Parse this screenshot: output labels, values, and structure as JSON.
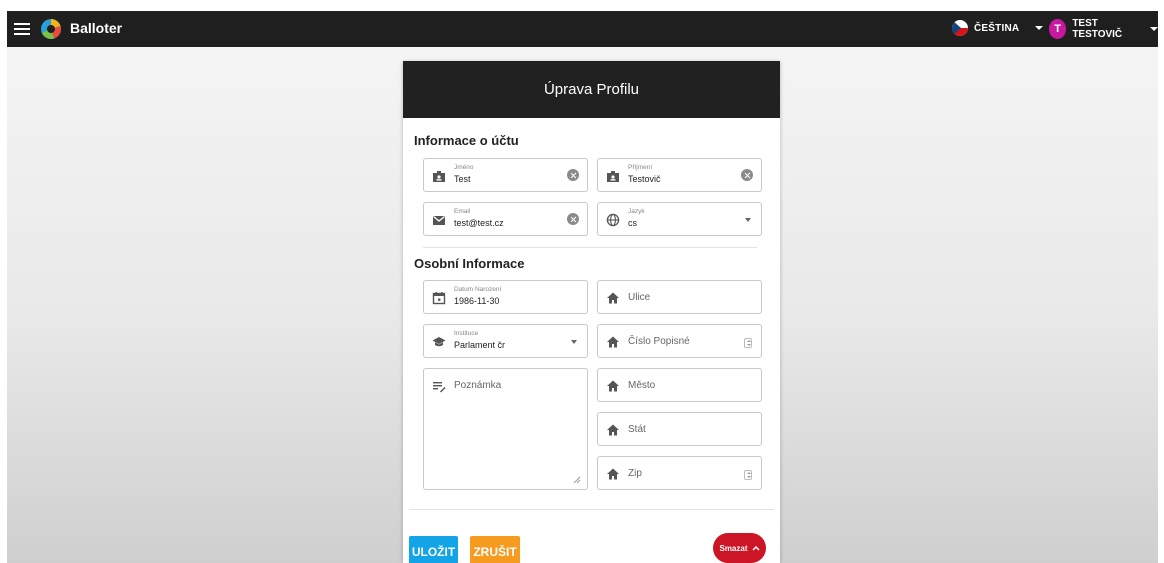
{
  "app": {
    "title": "Balloter"
  },
  "header": {
    "language": "ČEŠTINA",
    "user_initial": "T",
    "user_name": "TEST TESTOVIČ"
  },
  "card": {
    "title": "Úprava Profilu"
  },
  "account_section": {
    "title": "Informace o účtu",
    "first_name": {
      "label": "Jméno",
      "value": "Test"
    },
    "last_name": {
      "label": "Příjmení",
      "value": "Testovič"
    },
    "email": {
      "label": "Email",
      "value": "test@test.cz"
    },
    "language": {
      "label": "Jazyk",
      "value": "cs"
    }
  },
  "personal_section": {
    "title": "Osobní Informace",
    "birth_date": {
      "label": "Datum Narození",
      "value": "1986-11-30"
    },
    "street": {
      "placeholder": "Ulice"
    },
    "institution": {
      "label": "Instituce",
      "value": "Parlament čr"
    },
    "house_number": {
      "placeholder": "Číslo Popisné"
    },
    "note": {
      "placeholder": "Poznámka"
    },
    "city": {
      "placeholder": "Město"
    },
    "state": {
      "placeholder": "Stát"
    },
    "zip": {
      "placeholder": "Zip"
    }
  },
  "actions": {
    "save": "ULOŽIT",
    "cancel": "ZRUŠIT",
    "delete": "Smazat"
  },
  "colors": {
    "save": "#12a4e6",
    "cancel": "#f49b20",
    "delete": "#cc1525",
    "avatar": "#c8189f",
    "appbar": "#1f1f1f"
  }
}
